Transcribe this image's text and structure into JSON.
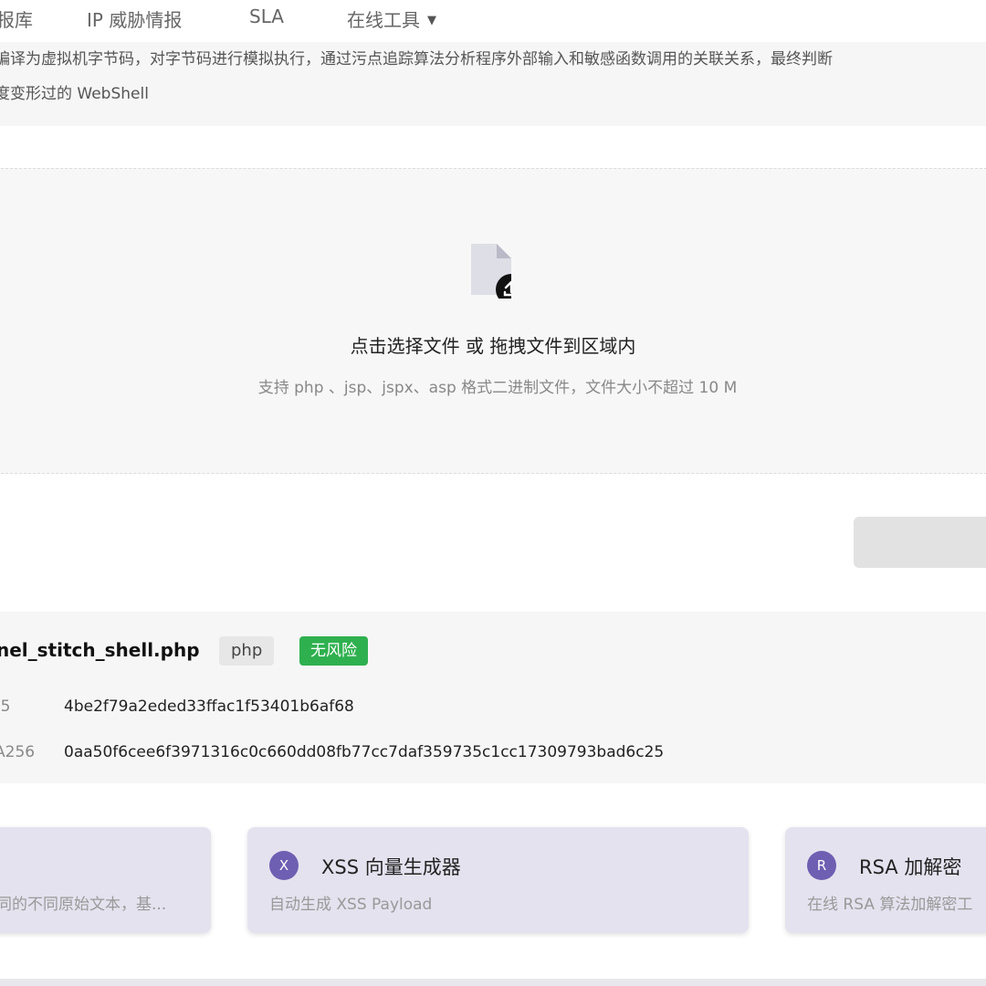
{
  "nav": {
    "items": [
      {
        "label": "报库"
      },
      {
        "label": "IP 威胁情报"
      },
      {
        "label": "SLA"
      },
      {
        "label": "在线工具"
      }
    ],
    "dropdown_icon": "caret-down-icon"
  },
  "description": {
    "line1": "编译为虚拟机字节码，对字节码进行模拟执行，通过污点追踪算法分析程序外部输入和敏感函数调用的关联关系，最终判断",
    "line2": "度变形过的 WebShell"
  },
  "upload": {
    "icon": "file-upload-icon",
    "title": "点击选择文件 或 拖拽文件到区域内",
    "hint": "支持 php 、jsp、jspx、asp 格式二进制文件，文件大小不超过 10 M"
  },
  "result": {
    "file_name": "nel_stitch_shell.php",
    "type_badge": "php",
    "risk_badge": "无风险",
    "risk_color": "#2fb04f",
    "hashes": [
      {
        "key": ")5",
        "value": "4be2f79a2eded33ffac1f53401b6af68"
      },
      {
        "key": "A256",
        "value": "0aa50f6cee6f3971316c0c660dd08fb77cc7daf359735c1cc17309793bad6c25"
      }
    ]
  },
  "tools": [
    {
      "logo": "",
      "title": "",
      "desc": "同的不同原始文本，基..."
    },
    {
      "logo": "X",
      "title": "XSS 向量生成器",
      "desc": "自动生成 XSS Payload"
    },
    {
      "logo": "R",
      "title": "RSA 加解密",
      "desc": "在线 RSA 算法加解密工"
    }
  ],
  "colors": {
    "accent": "#6e5fb2",
    "card_bg": "#e5e2ef",
    "panel_bg": "#f6f6f6"
  }
}
